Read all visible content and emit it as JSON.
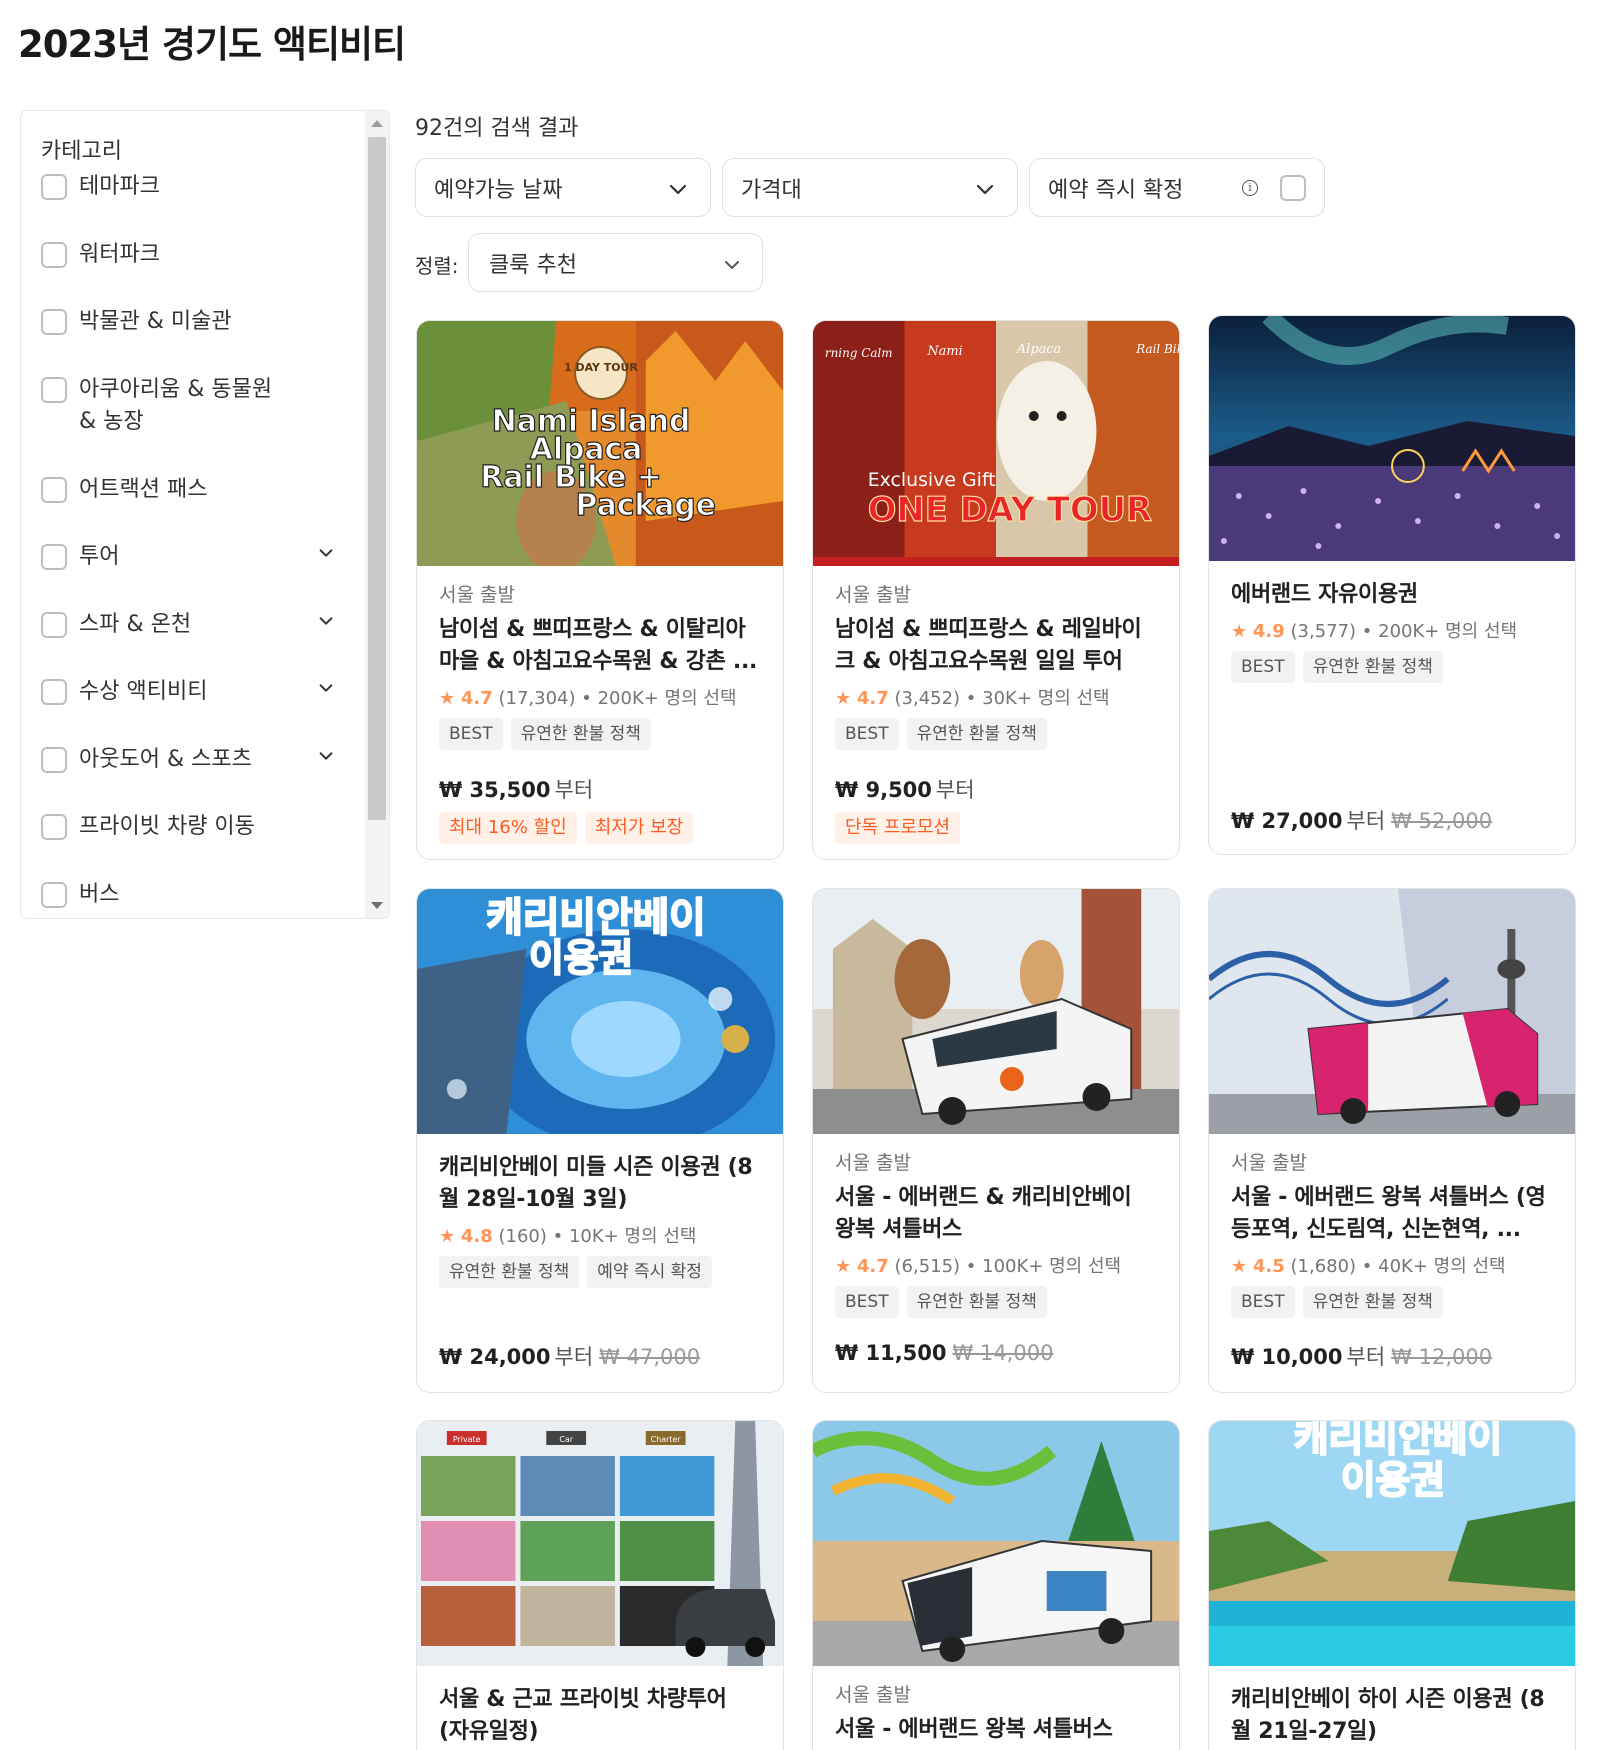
{
  "page": {
    "title": "2023년 경기도 액티비티"
  },
  "sidebar": {
    "category_title": "카테고리",
    "items": [
      {
        "label": "테마파크",
        "expandable": false
      },
      {
        "label": "워터파크",
        "expandable": false
      },
      {
        "label": "박물관 & 미술관",
        "expandable": false
      },
      {
        "label": "아쿠아리움 & 동물원 & 농장",
        "expandable": false
      },
      {
        "label": "어트랙션 패스",
        "expandable": false
      },
      {
        "label": "투어",
        "expandable": true
      },
      {
        "label": "스파 & 온천",
        "expandable": true
      },
      {
        "label": "수상 액티비티",
        "expandable": true
      },
      {
        "label": "아웃도어 & 스포츠",
        "expandable": true
      },
      {
        "label": "프라이빗 차량 이동",
        "expandable": false
      },
      {
        "label": "버스",
        "expandable": false
      }
    ]
  },
  "results": {
    "count_label": "92건의 검색 결과",
    "filters": {
      "date": "예약가능 날짜",
      "price": "가격대",
      "instant": "예약 즉시 확정"
    },
    "sort": {
      "label": "정렬:",
      "value": "클룩 추천"
    }
  },
  "cards": [
    {
      "origin": "서울 출발",
      "title": "남이섬 & 쁘띠프랑스 & 이탈리아 마을 & 아침고요수목원 & 강촌 ...",
      "rating": "4.7",
      "reviews": "(17,304)",
      "booked": "200K+ 명의 선택",
      "tags": [
        "BEST",
        "유연한 환불 정책"
      ],
      "price": "₩ 35,500",
      "price_suffix": "부터",
      "price_old": "",
      "promos": [
        "최대 16% 할인",
        "최저가 보장"
      ],
      "image_text": [
        "1 DAY TOUR",
        "Nami Island",
        "Alpaca",
        "Rail Bike +",
        "Package"
      ]
    },
    {
      "origin": "서울 출발",
      "title": "남이섬 & 쁘띠프랑스 & 레일바이크 & 아침고요수목원 일일 투어",
      "rating": "4.7",
      "reviews": "(3,452)",
      "booked": "30K+ 명의 선택",
      "tags": [
        "BEST",
        "유연한 환불 정책"
      ],
      "price": "₩ 9,500",
      "price_suffix": "부터",
      "price_old": "",
      "promos": [
        "단독 프로모션"
      ],
      "image_text": [
        "Exclusive Gift",
        "ONE DAY TOUR",
        "Nami",
        "Alpaca",
        "Rail Bik",
        "rning Calm"
      ]
    },
    {
      "origin": "",
      "title": "에버랜드 자유이용권",
      "rating": "4.9",
      "reviews": "(3,577)",
      "booked": "200K+ 명의 선택",
      "tags": [
        "BEST",
        "유연한 환불 정책"
      ],
      "price": "₩ 27,000",
      "price_suffix": "부터",
      "price_old": "₩ 52,000",
      "promos": [],
      "image_text": []
    },
    {
      "origin": "",
      "title": "캐리비안베이 미들 시즌 이용권 (8월 28일-10월 3일)",
      "rating": "4.8",
      "reviews": "(160)",
      "booked": "10K+ 명의 선택",
      "tags": [
        "유연한 환불 정책",
        "예약 즉시 확정"
      ],
      "price": "₩ 24,000",
      "price_suffix": "부터",
      "price_old": "₩ 47,000",
      "promos": [],
      "image_text": [
        "캐리비안베이",
        "이용권"
      ]
    },
    {
      "origin": "서울 출발",
      "title": "서울 - 에버랜드 & 캐리비안베이 왕복 셔틀버스",
      "rating": "4.7",
      "reviews": "(6,515)",
      "booked": "100K+ 명의 선택",
      "tags": [
        "BEST",
        "유연한 환불 정책"
      ],
      "price": "₩ 11,500",
      "price_suffix": "",
      "price_old": "₩ 14,000",
      "promos": [],
      "image_text": []
    },
    {
      "origin": "서울 출발",
      "title": "서울 - 에버랜드 왕복 셔틀버스 (영등포역, 신도림역, 신논현역, ...",
      "rating": "4.5",
      "reviews": "(1,680)",
      "booked": "40K+ 명의 선택",
      "tags": [
        "BEST",
        "유연한 환불 정책"
      ],
      "price": "₩ 10,000",
      "price_suffix": "부터",
      "price_old": "₩ 12,000",
      "promos": [],
      "image_text": []
    },
    {
      "origin": "",
      "title": "서울 & 근교 프라이빗 차량투어 (자유일정)",
      "image_text": [
        "Private",
        "Car",
        "Charter"
      ]
    },
    {
      "origin": "서울 출발",
      "title": "서울 - 에버랜드 왕복 셔틀버스",
      "image_text": []
    },
    {
      "origin": "",
      "title": "캐리비안베이 하이 시즌 이용권 (8월 21일-27일)",
      "image_text": [
        "캐리비안베이",
        "이용권"
      ]
    }
  ],
  "colors": {
    "accent_orange": "#ff5b1f",
    "star": "#ff9557",
    "promo_bg": "#fff0e8",
    "tag_bg": "#f2f2f2"
  }
}
